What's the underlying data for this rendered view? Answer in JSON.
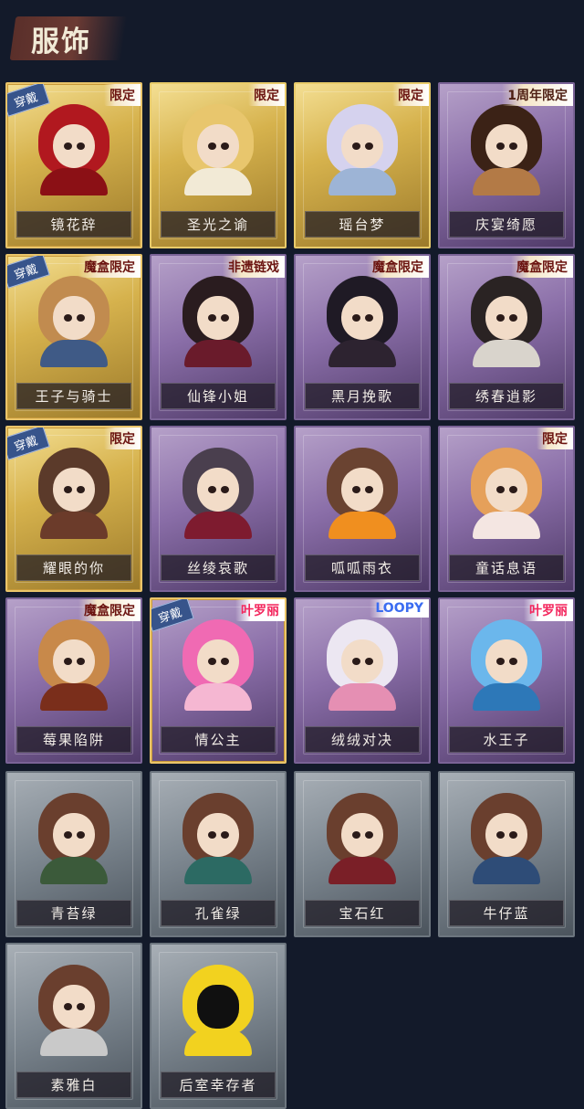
{
  "header": {
    "title": "服饰"
  },
  "badges": {
    "equipped": "穿戴"
  },
  "items": [
    {
      "name": "镜花辞",
      "tag": "限定",
      "equipped": true,
      "style": "gold",
      "hair": "#b1181f",
      "body": "#8b1015"
    },
    {
      "name": "圣光之谕",
      "tag": "限定",
      "equipped": false,
      "style": "gold",
      "hair": "#e8c66d",
      "body": "#f2ead6"
    },
    {
      "name": "瑶台梦",
      "tag": "限定",
      "equipped": false,
      "style": "gold",
      "hair": "#d5d2ee",
      "body": "#9db4d6"
    },
    {
      "name": "庆宴绮愿",
      "tag": "1周年限定",
      "equipped": false,
      "style": "purple",
      "hair": "#3b2216",
      "body": "#b37a46"
    },
    {
      "name": "王子与骑士",
      "tag": "魔盒限定",
      "equipped": true,
      "style": "gold",
      "hair": "#c18b4f",
      "body": "#3f5a86"
    },
    {
      "name": "仙锋小姐",
      "tag": "非遗链戏",
      "equipped": false,
      "style": "purple",
      "hair": "#2a1c1f",
      "body": "#6a1b2b"
    },
    {
      "name": "黑月挽歌",
      "tag": "魔盒限定",
      "equipped": false,
      "style": "purple",
      "hair": "#1f1a25",
      "body": "#2d2330"
    },
    {
      "name": "绣春逍影",
      "tag": "魔盒限定",
      "equipped": false,
      "style": "purple",
      "hair": "#2a2323",
      "body": "#d9d4cc"
    },
    {
      "name": "耀眼的你",
      "tag": "限定",
      "equipped": true,
      "style": "gold",
      "hair": "#5b3a2a",
      "body": "#6b3b2a"
    },
    {
      "name": "丝绫哀歌",
      "tag": "",
      "equipped": false,
      "style": "purple",
      "hair": "#4a3f4e",
      "body": "#7e1b2f"
    },
    {
      "name": "呱呱雨衣",
      "tag": "",
      "equipped": false,
      "style": "purple",
      "hair": "#6a4331",
      "body": "#f08f1f"
    },
    {
      "name": "童话息语",
      "tag": "限定",
      "equipped": false,
      "style": "purple",
      "hair": "#e5a05a",
      "body": "#f4e6e2"
    },
    {
      "name": "莓果陷阱",
      "tag": "魔盒限定",
      "equipped": false,
      "style": "purple",
      "hair": "#c8894a",
      "body": "#7a2e1b"
    },
    {
      "name": "情公主",
      "tag": "叶罗丽",
      "equipped": true,
      "style": "purple",
      "hair": "#f06ab3",
      "body": "#f5b7d2"
    },
    {
      "name": "绒绒对决",
      "tag": "LOOPY",
      "equipped": false,
      "style": "purple",
      "hair": "#ece7f2",
      "body": "#e58fb3"
    },
    {
      "name": "水王子",
      "tag": "叶罗丽",
      "equipped": false,
      "style": "purple",
      "hair": "#6bb7ec",
      "body": "#2d78b8"
    },
    {
      "name": "青苔绿",
      "tag": "",
      "equipped": false,
      "style": "grey",
      "hair": "#6a3f2e",
      "body": "#3b5a3a"
    },
    {
      "name": "孔雀绿",
      "tag": "",
      "equipped": false,
      "style": "grey",
      "hair": "#6a3f2e",
      "body": "#2c6a63"
    },
    {
      "name": "宝石红",
      "tag": "",
      "equipped": false,
      "style": "grey",
      "hair": "#6a3f2e",
      "body": "#7a1f27"
    },
    {
      "name": "牛仔蓝",
      "tag": "",
      "equipped": false,
      "style": "grey",
      "hair": "#6a3f2e",
      "body": "#2e4c77"
    },
    {
      "name": "素雅白",
      "tag": "",
      "equipped": false,
      "style": "grey",
      "hair": "#6a3f2e",
      "body": "#c9c9c9"
    },
    {
      "name": "后室幸存者",
      "tag": "",
      "equipped": false,
      "style": "grey",
      "hair": "#f2d21f",
      "body": "#f2d21f",
      "special": "hazmat"
    }
  ]
}
